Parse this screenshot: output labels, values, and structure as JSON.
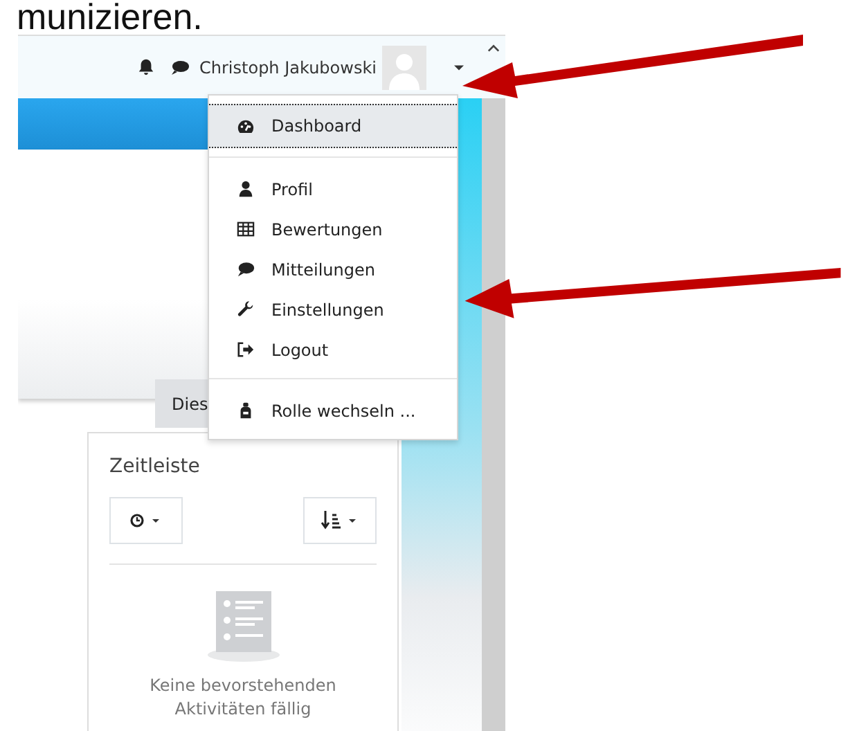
{
  "document": {
    "heading_fragment": "munizieren."
  },
  "navbar": {
    "user_name": "Christoph Jakubowski"
  },
  "user_menu": {
    "sections": [
      {
        "items": [
          {
            "label": "Dashboard",
            "selected": true
          }
        ]
      },
      {
        "items": [
          {
            "label": "Profil",
            "selected": false
          },
          {
            "label": "Bewertungen",
            "selected": false
          },
          {
            "label": "Mitteilungen",
            "selected": false
          },
          {
            "label": "Einstellungen",
            "selected": false
          },
          {
            "label": "Logout",
            "selected": false
          }
        ]
      },
      {
        "items": [
          {
            "label": "Rolle wechseln ...",
            "selected": false
          }
        ]
      }
    ]
  },
  "page_header": {
    "button_fragment": "Dies"
  },
  "timeline_block": {
    "title": "Zeitleiste",
    "empty_message": "Keine bevorstehenden Aktivitäten fällig"
  }
}
